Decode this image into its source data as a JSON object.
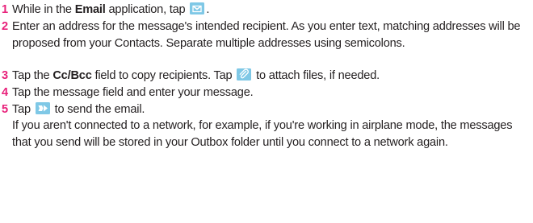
{
  "steps": [
    {
      "num": "1",
      "pre": "While in the ",
      "bold": "Email",
      "mid": " application, tap ",
      "post": "."
    },
    {
      "num": "2",
      "text": "Enter an address for the message's intended recipient. As you enter text, matching addresses will be proposed from your Contacts. Separate multiple addresses using semicolons."
    },
    {
      "num": "3",
      "pre": "Tap the ",
      "bold": "Cc/Bcc",
      "mid": " field to copy recipients. Tap ",
      "post": " to attach files, if needed."
    },
    {
      "num": "4",
      "text": "Tap the message field and enter your message."
    },
    {
      "num": "5",
      "pre": "Tap ",
      "post": " to send the email."
    }
  ],
  "note": "If you aren't connected to a network, for example, if you're working in airplane mode, the messages that you send will be stored in your Outbox folder until you connect to a network again.",
  "icons": {
    "compose": "compose-email-icon",
    "attach": "paperclip-icon",
    "send": "send-icon",
    "accent": "#e8207a",
    "icon_bg": "#7fc8e6"
  }
}
